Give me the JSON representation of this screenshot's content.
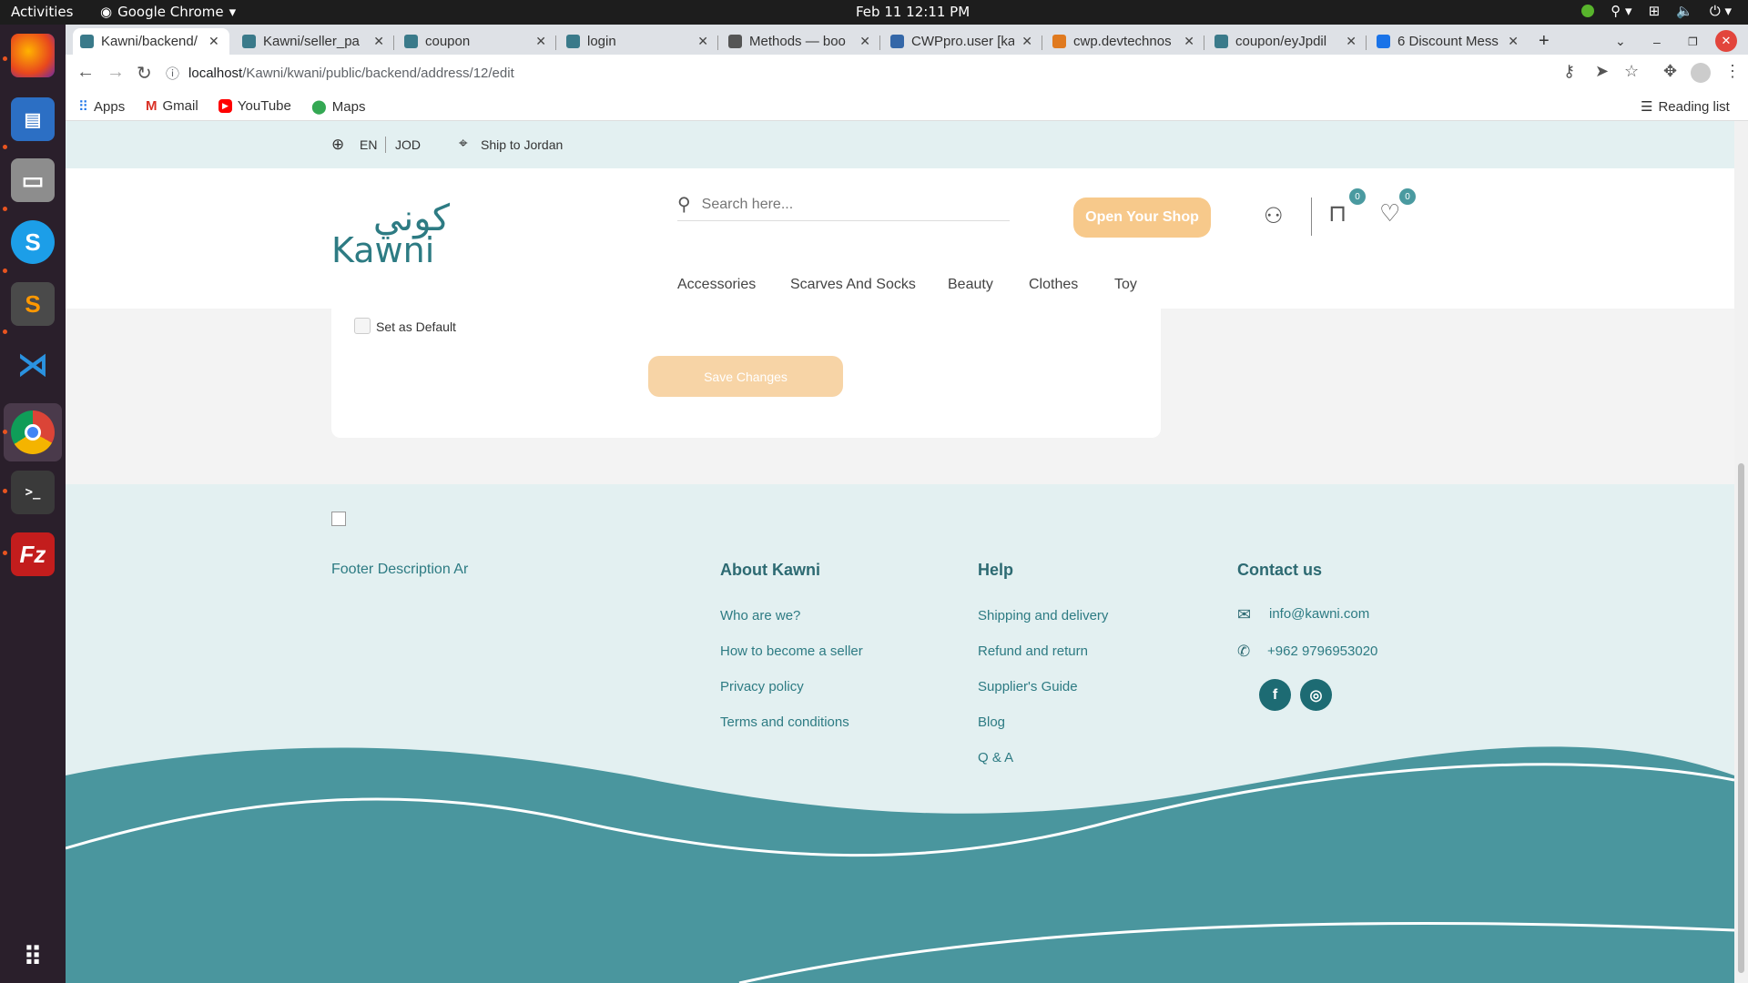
{
  "system": {
    "activities": "Activities",
    "app_name": "Google Chrome",
    "clock": "Feb 11  12:11 PM"
  },
  "tabs": [
    {
      "title": "Kawni/backend/",
      "active": true
    },
    {
      "title": "Kawni/seller_pa"
    },
    {
      "title": "coupon"
    },
    {
      "title": "login"
    },
    {
      "title": "Methods — boo"
    },
    {
      "title": "CWPpro.user [ka"
    },
    {
      "title": "cwp.devtechnos"
    },
    {
      "title": "coupon/eyJpdil"
    },
    {
      "title": "6 Discount Mess"
    }
  ],
  "address": {
    "host": "localhost",
    "path": "/Kawni/kwani/public/backend/address/12/edit"
  },
  "bookmarks": {
    "apps": "Apps",
    "gmail": "Gmail",
    "youtube": "YouTube",
    "maps": "Maps",
    "reading_list": "Reading list"
  },
  "site": {
    "lang": "EN",
    "currency": "JOD",
    "ship_to": "Ship to Jordan",
    "logo_arabic": "كوني",
    "logo_latin": "Kawni",
    "search_placeholder": "Search here...",
    "open_shop": "Open Your Shop",
    "cart_count": "0",
    "wishlist_count": "0",
    "menu": [
      "Accessories",
      "Scarves And Socks",
      "Beauty",
      "Clothes",
      "Toy"
    ],
    "set_default": "Set as Default",
    "save_changes": "Save Changes"
  },
  "footer": {
    "description": "Footer Description Ar",
    "about": {
      "title": "About Kawni",
      "links": [
        "Who are we?",
        "How to become a seller",
        "Privacy policy",
        "Terms and conditions"
      ]
    },
    "help": {
      "title": "Help",
      "links": [
        "Shipping and delivery",
        "Refund and return",
        "Supplier's Guide",
        "Blog",
        "Q & A"
      ]
    },
    "contact": {
      "title": "Contact us",
      "email": "info@kawni.com",
      "phone": "+962 9796953020"
    }
  },
  "colors": {
    "teal": "#4a969e",
    "accent": "#f7c98b",
    "dark_teal": "#1d6b73"
  }
}
